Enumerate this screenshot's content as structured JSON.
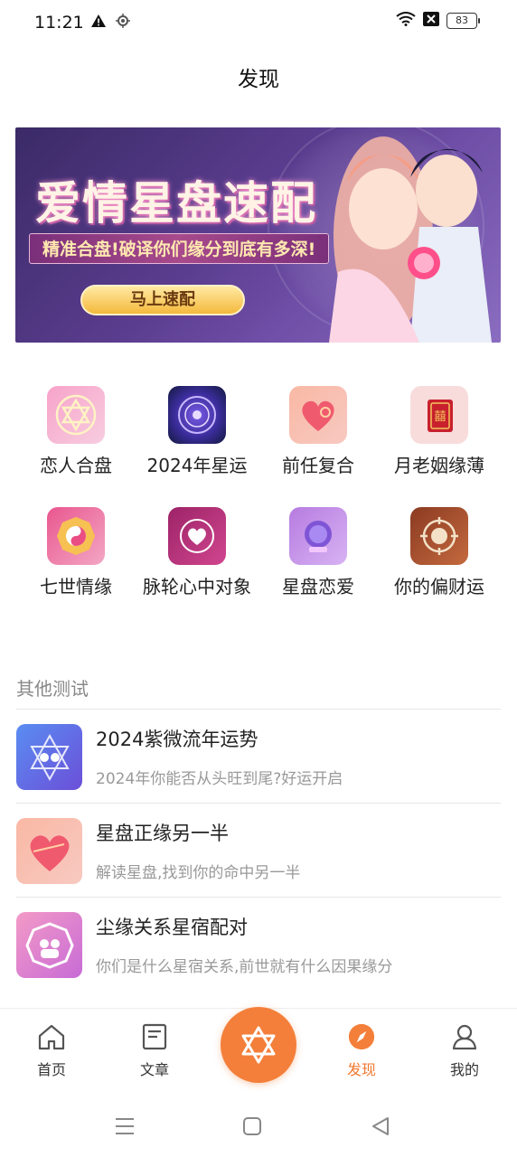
{
  "status": {
    "time": "11:21",
    "battery": "83"
  },
  "header": {
    "title": "发现"
  },
  "banner": {
    "title": "爱情星盘速配",
    "subtitle": "精准合盘!破译你们缘分到底有多深!",
    "button": "马上速配"
  },
  "grid": [
    {
      "label": "恋人合盘",
      "icon": "hexagram-icon",
      "color": "#f7a3c9"
    },
    {
      "label": "2024年星运",
      "icon": "zodiac-wheel-icon",
      "color": "#2b2a7a"
    },
    {
      "label": "前任复合",
      "icon": "heart-icon",
      "color": "#f79b9b"
    },
    {
      "label": "月老姻缘薄",
      "icon": "red-book-icon",
      "color": "#f8dcdc"
    },
    {
      "label": "七世情缘",
      "icon": "bagua-icon",
      "color": "#e9568f"
    },
    {
      "label": "脉轮心中对象",
      "icon": "lotus-heart-icon",
      "color": "#b8337a"
    },
    {
      "label": "星盘恋爱",
      "icon": "crystal-ball-icon",
      "color": "#b67be0"
    },
    {
      "label": "你的偏财运",
      "icon": "mandala-icon",
      "color": "#a14a2a"
    }
  ],
  "section": {
    "title": "其他测试"
  },
  "list": [
    {
      "title": "2024紫微流年运势",
      "subtitle": "2024年你能否从头旺到尾?好运开启",
      "icon": "star-couple-icon"
    },
    {
      "title": "星盘正缘另一半",
      "subtitle": "解读星盘,找到你的命中另一半",
      "icon": "heart-arrow-icon"
    },
    {
      "title": "尘缘关系星宿配对",
      "subtitle": "你们是什么星宿关系,前世就有什么因果缘分",
      "icon": "bagua-couple-icon"
    }
  ],
  "nav": {
    "home": "首页",
    "article": "文章",
    "discover": "发现",
    "mine": "我的"
  },
  "colors": {
    "accent": "#f47f3a"
  }
}
